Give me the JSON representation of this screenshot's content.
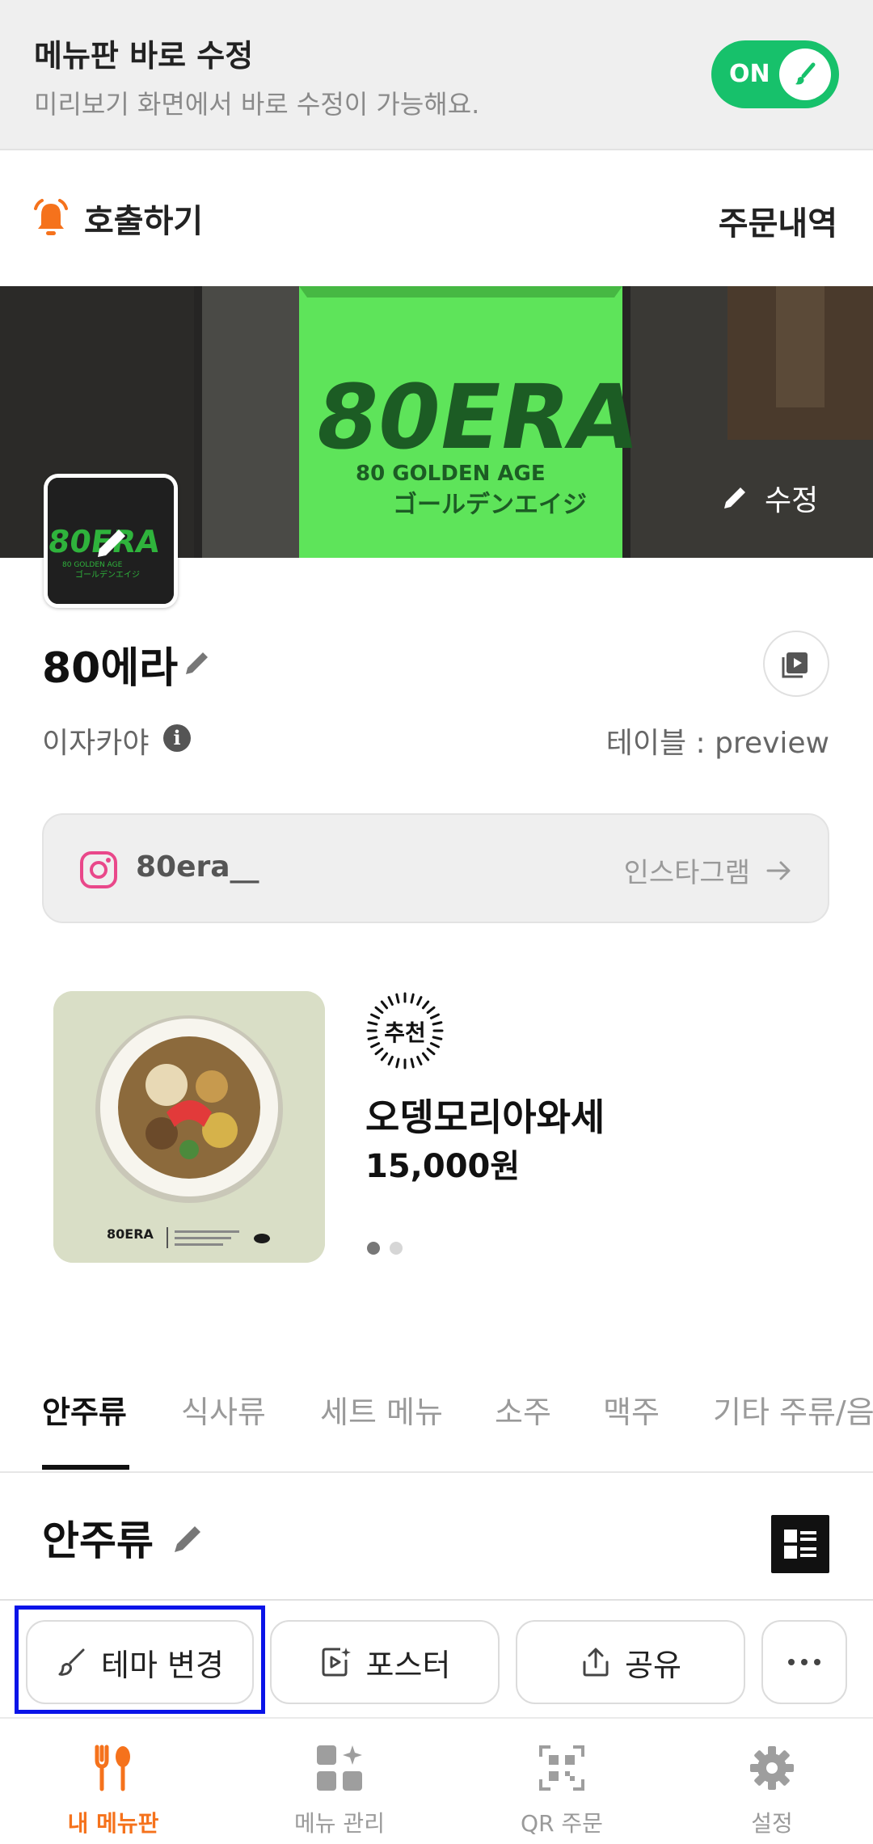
{
  "edit_banner": {
    "title": "메뉴판 바로 수정",
    "subtitle": "미리보기 화면에서 바로 수정이 가능해요.",
    "toggle_label": "ON",
    "toggle_on": true,
    "toggle_color": "#17c16b"
  },
  "call_row": {
    "call_label": "호출하기",
    "orders_label": "주문내역",
    "bell_icon": "bell-icon",
    "accent_color": "#f5721c"
  },
  "cover": {
    "edit_label": "수정",
    "logo_lines": [
      "80ERA",
      "80 GOLDEN AGE",
      "ゴールデンエイジ"
    ]
  },
  "store": {
    "name": "80에라",
    "category": "이자카야",
    "table_label": "테이블 : preview"
  },
  "instagram": {
    "handle": "80era__",
    "link_label": "인스타그램"
  },
  "recommendation": {
    "badge": "추천",
    "name": "오뎅모리아와세",
    "price": "15,000원",
    "page_index": 1,
    "page_count": 2
  },
  "tabs": [
    {
      "label": "안주류",
      "active": true
    },
    {
      "label": "식사류",
      "active": false
    },
    {
      "label": "세트 메뉴",
      "active": false
    },
    {
      "label": "소주",
      "active": false
    },
    {
      "label": "맥주",
      "active": false
    },
    {
      "label": "기타 주류/음",
      "active": false
    }
  ],
  "section": {
    "title": "안주류"
  },
  "action_bar": {
    "theme_label": "테마 변경",
    "poster_label": "포스터",
    "share_label": "공유"
  },
  "bottom_nav": [
    {
      "label": "내 메뉴판",
      "icon": "fork-spoon-icon",
      "active": true
    },
    {
      "label": "메뉴 관리",
      "icon": "grid-sparkle-icon",
      "active": false
    },
    {
      "label": "QR 주문",
      "icon": "qr-code-icon",
      "active": false
    },
    {
      "label": "설정",
      "icon": "gear-icon",
      "active": false
    }
  ]
}
